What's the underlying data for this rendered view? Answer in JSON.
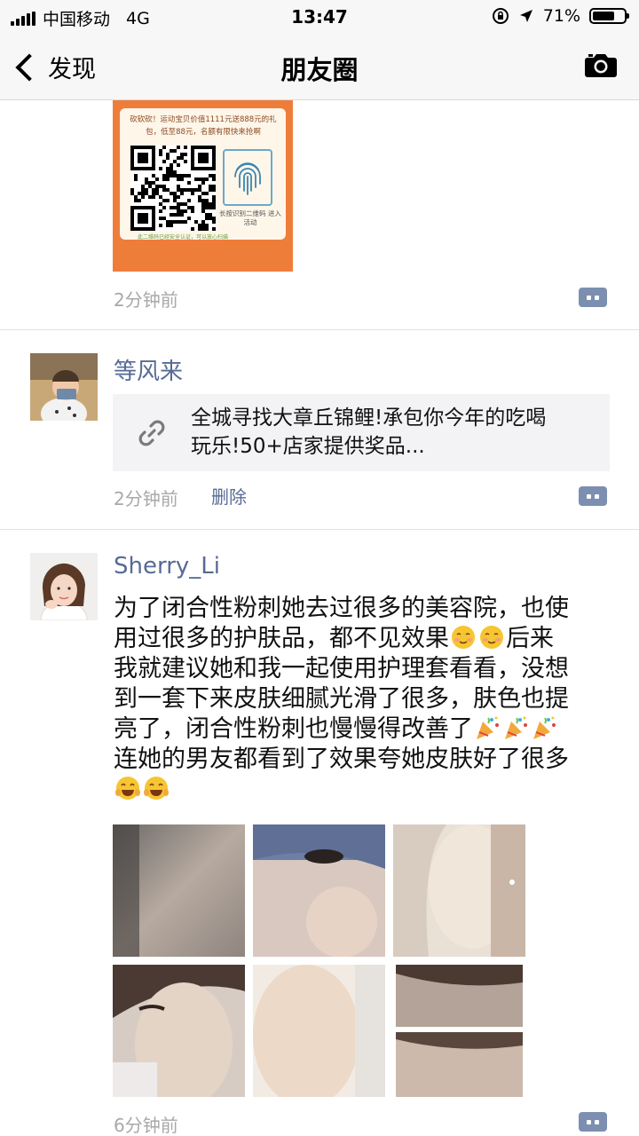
{
  "status_bar": {
    "carrier": "中国移动",
    "network": "4G",
    "time": "13:47",
    "battery": "71%",
    "battery_level": 0.71
  },
  "nav": {
    "back_label": "发现",
    "title": "朋友圈"
  },
  "posts": [
    {
      "poster_text": "砍砍砍！运动宝贝价值1111元送888元的礼包，低至88元，名额有限快来抢啊",
      "poster_fp_text": "长按识别二维码 进入活动",
      "poster_footer": "此二维码已经安全认证，可以放心扫描",
      "time": "2分钟前"
    },
    {
      "author": "等风来",
      "link_title_line1": "全城寻找大章丘锦鲤!承包你今年的吃喝",
      "link_title_line2": "玩乐!50+店家提供奖品...",
      "time": "2分钟前",
      "delete_label": "删除"
    },
    {
      "author": "Sherry_Li",
      "text_lines": [
        "为了闭合性粉刺她去过很多的美容院，也使",
        "用过很多的护肤品，都不见效果",
        "后来",
        "我就建议她和我一起使用护理套看看，没想",
        "到一套下来皮肤细腻光滑了很多，肤色也提",
        "亮了，闭合性粉刺也慢慢得改善了",
        "连她的男友都看到了效果夸她皮肤好了很多"
      ],
      "photo_count": 6,
      "time": "6分钟前"
    }
  ],
  "colors": {
    "link_name": "#576b95",
    "time_gray": "#a8a8a8",
    "poster_orange": "#ef7d3a",
    "link_card_bg": "#f3f3f5"
  },
  "icons": [
    "back-chevron-icon",
    "camera-icon",
    "link-icon",
    "comment-icon",
    "fingerprint-icon",
    "smile-emoji-icon",
    "party-popper-emoji-icon",
    "grin-emoji-icon"
  ]
}
